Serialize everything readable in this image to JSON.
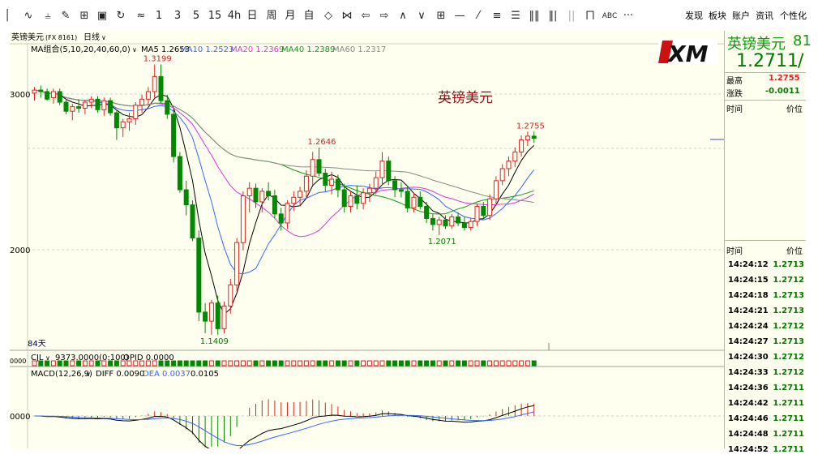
{
  "toolbar": {
    "tools": [
      "line-chart-icon",
      "candle-icon",
      "draw-icon",
      "grid-icon",
      "save-icon",
      "refresh-icon",
      "compare-icon"
    ],
    "periods": [
      "1",
      "3",
      "5",
      "15",
      "4h",
      "日",
      "周",
      "月",
      "自"
    ],
    "nav_icons": [
      "diamond-icon",
      "bowtie-icon",
      "arrow-left-icon",
      "arrow-right-icon",
      "chevron-up-icon",
      "chevron-down-icon",
      "table-icon",
      "dash-icon",
      "slash-icon",
      "zoom-icon",
      "bars-icon",
      "bars2-icon",
      "bars3-icon",
      "volume-icon"
    ],
    "abc_label": "ABC",
    "more_label": "···",
    "right_menu": [
      "发现",
      "板块",
      "账户",
      "资讯",
      "个性化"
    ]
  },
  "chart_header": {
    "symbol_label": "英镑美元",
    "symbol_code": "(FX 8161)",
    "period_label": "日线",
    "ma_group_label": "MA组合(5,10,20,40,60,0)",
    "ma5_label": "MA5 1.2653",
    "ma10_label": "MA10 1.2523",
    "ma20_label": "MA20 1.2369",
    "ma40_label": "MA40 1.2389",
    "ma60_label": "MA60 1.2317"
  },
  "colors": {
    "up": "#dd2222",
    "down": "#008800",
    "ma5": "#000000",
    "ma10": "#3366ff",
    "ma20": "#dd33dd",
    "ma40": "#119911",
    "ma60": "#888888",
    "bg": "#fffff0"
  },
  "watermark_title": "英镑美元",
  "logo_text": "XM",
  "price_axis": {
    "label_top": "3000",
    "label_mid": "2000",
    "label_macd": "0000"
  },
  "day_count_label": "84天",
  "volume_header": {
    "name": "CJL",
    "values": "9373.0000(0:100)",
    "opid": "OPID 0.0000"
  },
  "volume_axis_label": "0000",
  "macd_header": {
    "name": "MACD(12,26,9)",
    "diff": "DIFF 0.0090",
    "dea": "DEA 0.0037",
    "macd": "0.0105"
  },
  "chart_data": {
    "type": "candlestick",
    "symbol": "英镑美元",
    "period": "日线",
    "annotations": [
      {
        "label": "1.3199",
        "kind": "high"
      },
      {
        "label": "1.2646",
        "kind": "local-high"
      },
      {
        "label": "1.2755",
        "kind": "recent-high"
      },
      {
        "label": "1.2071",
        "kind": "local-low"
      },
      {
        "label": "1.1409",
        "kind": "low"
      }
    ],
    "ma_last": {
      "MA5": 1.2653,
      "MA10": 1.2523,
      "MA20": 1.2369,
      "MA40": 1.2389,
      "MA60": 1.2317
    },
    "candles": [
      {
        "o": 1.301,
        "h": 1.305,
        "l": 1.296,
        "c": 1.303
      },
      {
        "o": 1.303,
        "h": 1.306,
        "l": 1.298,
        "c": 1.302
      },
      {
        "o": 1.302,
        "h": 1.304,
        "l": 1.296,
        "c": 1.297
      },
      {
        "o": 1.298,
        "h": 1.304,
        "l": 1.294,
        "c": 1.302
      },
      {
        "o": 1.302,
        "h": 1.304,
        "l": 1.293,
        "c": 1.295
      },
      {
        "o": 1.295,
        "h": 1.297,
        "l": 1.287,
        "c": 1.289
      },
      {
        "o": 1.289,
        "h": 1.294,
        "l": 1.283,
        "c": 1.292
      },
      {
        "o": 1.292,
        "h": 1.297,
        "l": 1.288,
        "c": 1.291
      },
      {
        "o": 1.291,
        "h": 1.296,
        "l": 1.287,
        "c": 1.295
      },
      {
        "o": 1.295,
        "h": 1.299,
        "l": 1.291,
        "c": 1.297
      },
      {
        "o": 1.297,
        "h": 1.299,
        "l": 1.288,
        "c": 1.29
      },
      {
        "o": 1.29,
        "h": 1.298,
        "l": 1.286,
        "c": 1.296
      },
      {
        "o": 1.296,
        "h": 1.298,
        "l": 1.286,
        "c": 1.288
      },
      {
        "o": 1.288,
        "h": 1.29,
        "l": 1.27,
        "c": 1.278
      },
      {
        "o": 1.278,
        "h": 1.284,
        "l": 1.272,
        "c": 1.282
      },
      {
        "o": 1.282,
        "h": 1.288,
        "l": 1.276,
        "c": 1.284
      },
      {
        "o": 1.284,
        "h": 1.295,
        "l": 1.28,
        "c": 1.293
      },
      {
        "o": 1.293,
        "h": 1.3,
        "l": 1.288,
        "c": 1.297
      },
      {
        "o": 1.297,
        "h": 1.305,
        "l": 1.293,
        "c": 1.302
      },
      {
        "o": 1.302,
        "h": 1.32,
        "l": 1.298,
        "c": 1.312
      },
      {
        "o": 1.312,
        "h": 1.32,
        "l": 1.294,
        "c": 1.296
      },
      {
        "o": 1.296,
        "h": 1.3,
        "l": 1.284,
        "c": 1.287
      },
      {
        "o": 1.287,
        "h": 1.29,
        "l": 1.255,
        "c": 1.259
      },
      {
        "o": 1.259,
        "h": 1.262,
        "l": 1.235,
        "c": 1.237
      },
      {
        "o": 1.237,
        "h": 1.243,
        "l": 1.22,
        "c": 1.227
      },
      {
        "o": 1.227,
        "h": 1.23,
        "l": 1.203,
        "c": 1.205
      },
      {
        "o": 1.205,
        "h": 1.21,
        "l": 1.15,
        "c": 1.156
      },
      {
        "o": 1.156,
        "h": 1.162,
        "l": 1.142,
        "c": 1.15
      },
      {
        "o": 1.15,
        "h": 1.164,
        "l": 1.141,
        "c": 1.162
      },
      {
        "o": 1.162,
        "h": 1.167,
        "l": 1.141,
        "c": 1.145
      },
      {
        "o": 1.145,
        "h": 1.163,
        "l": 1.142,
        "c": 1.16
      },
      {
        "o": 1.16,
        "h": 1.178,
        "l": 1.155,
        "c": 1.174
      },
      {
        "o": 1.174,
        "h": 1.205,
        "l": 1.17,
        "c": 1.202
      },
      {
        "o": 1.202,
        "h": 1.236,
        "l": 1.197,
        "c": 1.233
      },
      {
        "o": 1.233,
        "h": 1.242,
        "l": 1.222,
        "c": 1.238
      },
      {
        "o": 1.238,
        "h": 1.241,
        "l": 1.225,
        "c": 1.229
      },
      {
        "o": 1.229,
        "h": 1.238,
        "l": 1.222,
        "c": 1.236
      },
      {
        "o": 1.236,
        "h": 1.242,
        "l": 1.23,
        "c": 1.233
      },
      {
        "o": 1.233,
        "h": 1.237,
        "l": 1.218,
        "c": 1.221
      },
      {
        "o": 1.221,
        "h": 1.225,
        "l": 1.21,
        "c": 1.215
      },
      {
        "o": 1.215,
        "h": 1.23,
        "l": 1.211,
        "c": 1.228
      },
      {
        "o": 1.228,
        "h": 1.236,
        "l": 1.223,
        "c": 1.232
      },
      {
        "o": 1.232,
        "h": 1.239,
        "l": 1.226,
        "c": 1.236
      },
      {
        "o": 1.236,
        "h": 1.25,
        "l": 1.231,
        "c": 1.246
      },
      {
        "o": 1.246,
        "h": 1.262,
        "l": 1.24,
        "c": 1.257
      },
      {
        "o": 1.257,
        "h": 1.265,
        "l": 1.246,
        "c": 1.248
      },
      {
        "o": 1.248,
        "h": 1.251,
        "l": 1.236,
        "c": 1.24
      },
      {
        "o": 1.24,
        "h": 1.249,
        "l": 1.234,
        "c": 1.244
      },
      {
        "o": 1.244,
        "h": 1.247,
        "l": 1.232,
        "c": 1.237
      },
      {
        "o": 1.237,
        "h": 1.241,
        "l": 1.222,
        "c": 1.226
      },
      {
        "o": 1.226,
        "h": 1.236,
        "l": 1.222,
        "c": 1.233
      },
      {
        "o": 1.233,
        "h": 1.24,
        "l": 1.224,
        "c": 1.228
      },
      {
        "o": 1.228,
        "h": 1.238,
        "l": 1.224,
        "c": 1.235
      },
      {
        "o": 1.235,
        "h": 1.241,
        "l": 1.229,
        "c": 1.238
      },
      {
        "o": 1.238,
        "h": 1.249,
        "l": 1.234,
        "c": 1.245
      },
      {
        "o": 1.245,
        "h": 1.262,
        "l": 1.24,
        "c": 1.256
      },
      {
        "o": 1.256,
        "h": 1.259,
        "l": 1.24,
        "c": 1.243
      },
      {
        "o": 1.243,
        "h": 1.246,
        "l": 1.232,
        "c": 1.237
      },
      {
        "o": 1.237,
        "h": 1.242,
        "l": 1.232,
        "c": 1.236
      },
      {
        "o": 1.236,
        "h": 1.239,
        "l": 1.222,
        "c": 1.225
      },
      {
        "o": 1.225,
        "h": 1.235,
        "l": 1.222,
        "c": 1.232
      },
      {
        "o": 1.232,
        "h": 1.236,
        "l": 1.224,
        "c": 1.226
      },
      {
        "o": 1.226,
        "h": 1.229,
        "l": 1.215,
        "c": 1.218
      },
      {
        "o": 1.218,
        "h": 1.221,
        "l": 1.21,
        "c": 1.214
      },
      {
        "o": 1.214,
        "h": 1.219,
        "l": 1.207,
        "c": 1.217
      },
      {
        "o": 1.217,
        "h": 1.22,
        "l": 1.211,
        "c": 1.213
      },
      {
        "o": 1.213,
        "h": 1.221,
        "l": 1.211,
        "c": 1.219
      },
      {
        "o": 1.219,
        "h": 1.222,
        "l": 1.213,
        "c": 1.215
      },
      {
        "o": 1.215,
        "h": 1.219,
        "l": 1.21,
        "c": 1.212
      },
      {
        "o": 1.212,
        "h": 1.218,
        "l": 1.21,
        "c": 1.216
      },
      {
        "o": 1.216,
        "h": 1.228,
        "l": 1.213,
        "c": 1.226
      },
      {
        "o": 1.226,
        "h": 1.229,
        "l": 1.218,
        "c": 1.22
      },
      {
        "o": 1.22,
        "h": 1.234,
        "l": 1.217,
        "c": 1.231
      },
      {
        "o": 1.231,
        "h": 1.246,
        "l": 1.228,
        "c": 1.243
      },
      {
        "o": 1.243,
        "h": 1.254,
        "l": 1.24,
        "c": 1.251
      },
      {
        "o": 1.251,
        "h": 1.259,
        "l": 1.246,
        "c": 1.256
      },
      {
        "o": 1.256,
        "h": 1.265,
        "l": 1.252,
        "c": 1.262
      },
      {
        "o": 1.262,
        "h": 1.273,
        "l": 1.259,
        "c": 1.27
      },
      {
        "o": 1.27,
        "h": 1.2755,
        "l": 1.266,
        "c": 1.2725
      },
      {
        "o": 1.2725,
        "h": 1.2755,
        "l": 1.268,
        "c": 1.2711
      }
    ],
    "ylim": [
      1.135,
      1.324
    ]
  },
  "right_panel": {
    "quote_name": "英镑美元",
    "quote_code": "81",
    "last_price": "1.2711",
    "last_price_suffix": "/",
    "high_label": "最高",
    "high_value": "1.2755",
    "change_label": "涨跌",
    "change_value": "-0.0011",
    "col_time": "时间",
    "col_price": "价位",
    "col_time2": "时间",
    "col_price2": "价位",
    "ticks": [
      {
        "time": "14:24:12",
        "price": "1.2713"
      },
      {
        "time": "14:24:15",
        "price": "1.2712"
      },
      {
        "time": "14:24:18",
        "price": "1.2713"
      },
      {
        "time": "14:24:21",
        "price": "1.2713"
      },
      {
        "time": "14:24:24",
        "price": "1.2712"
      },
      {
        "time": "14:24:27",
        "price": "1.2713"
      },
      {
        "time": "14:24:30",
        "price": "1.2712"
      },
      {
        "time": "14:24:33",
        "price": "1.2712"
      },
      {
        "time": "14:24:36",
        "price": "1.2711"
      },
      {
        "time": "14:24:42",
        "price": "1.2711"
      },
      {
        "time": "14:24:46",
        "price": "1.2711"
      },
      {
        "time": "14:24:48",
        "price": "1.2711"
      },
      {
        "time": "14:24:52",
        "price": "1.2711"
      }
    ]
  }
}
